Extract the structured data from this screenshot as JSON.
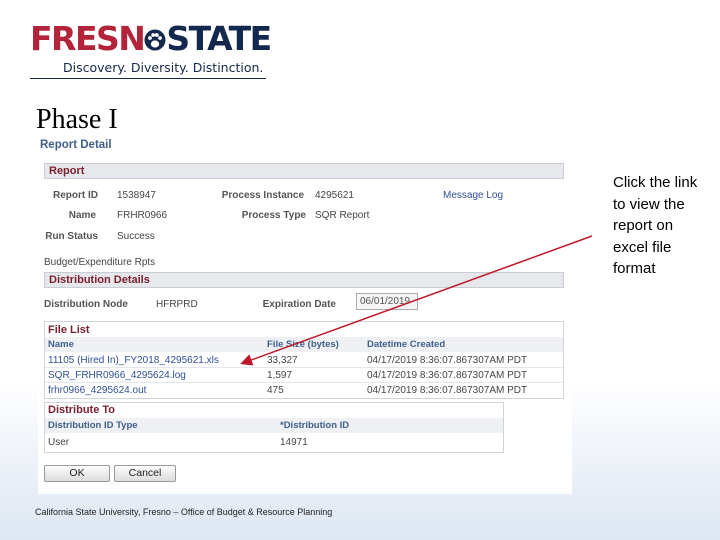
{
  "logo": {
    "name_left": "FRESN",
    "name_right": "STATE",
    "tagline": "Discovery. Diversity. Distinction."
  },
  "slide": {
    "title": "Phase I",
    "callout": "Click the link to view the report on excel file format",
    "footer": "California State University, Fresno – Office of Budget & Resource Planning"
  },
  "report_detail": {
    "page_title": "Report Detail",
    "report_section": "Report",
    "labels": {
      "report_id": "Report ID",
      "process_instance": "Process Instance",
      "name": "Name",
      "process_type": "Process Type",
      "run_status": "Run Status"
    },
    "values": {
      "report_id": "1538947",
      "process_instance": "4295621",
      "name": "FRHR0966",
      "process_type": "SQR Report",
      "run_status": "Success"
    },
    "message_log": "Message Log",
    "description": "Budget/Expenditure Rpts",
    "distribution": {
      "header": "Distribution Details",
      "node_label": "Distribution Node",
      "node_value": "HFRPRD",
      "expiration_label": "Expiration Date",
      "expiration_value": "06/01/2019"
    },
    "file_list": {
      "header": "File List",
      "columns": [
        "Name",
        "File Size (bytes)",
        "Datetime Created"
      ],
      "rows": [
        {
          "name": "11105 (Hired In)_FY2018_4295621.xls",
          "size": "33,327",
          "datetime": "04/17/2019  8:36:07.867307AM PDT"
        },
        {
          "name": "SQR_FRHR0966_4295624.log",
          "size": "1,597",
          "datetime": "04/17/2019  8:36:07.867307AM PDT"
        },
        {
          "name": "frhr0966_4295624.out",
          "size": "475",
          "datetime": "04/17/2019  8:36:07.867307AM PDT"
        }
      ]
    },
    "distribute_to": {
      "header": "Distribute To",
      "columns": [
        "Distribution ID Type",
        "*Distribution ID"
      ],
      "row": {
        "type": "User",
        "id": "14971"
      }
    },
    "buttons": {
      "ok": "OK",
      "cancel": "Cancel"
    }
  },
  "colors": {
    "logo_red": "#b3243b",
    "logo_navy": "#13284c",
    "section_title": "#7a2030",
    "link_blue": "#2f4f96",
    "arrow_red": "#c0182a"
  }
}
